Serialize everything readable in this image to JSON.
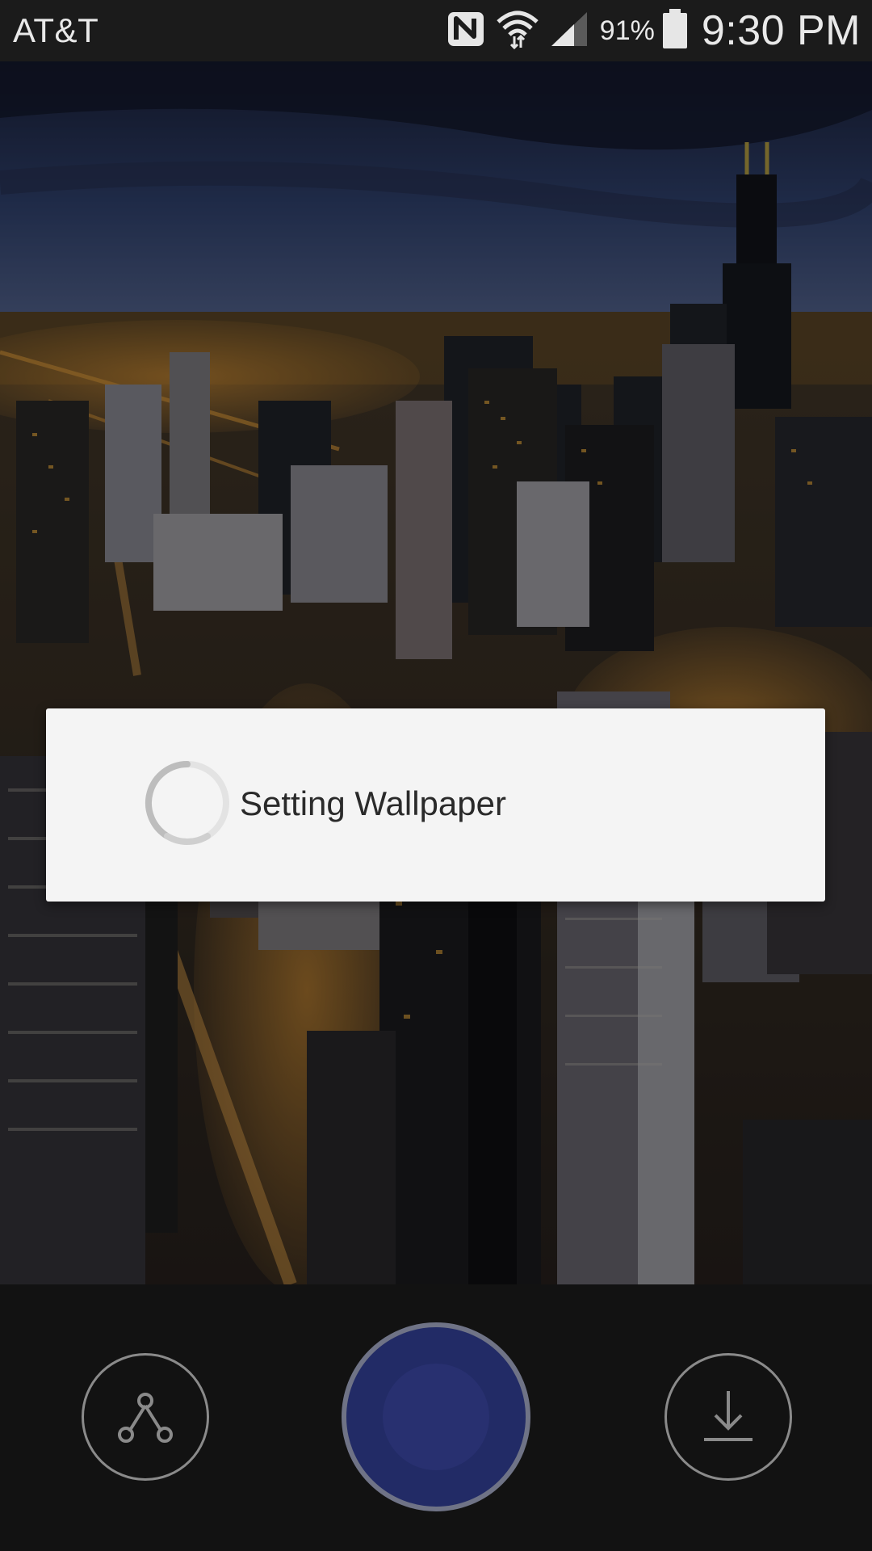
{
  "status_bar": {
    "carrier": "AT&T",
    "battery_percent": "91%",
    "time": "9:30 PM",
    "icons": [
      "nfc-icon",
      "wifi-icon",
      "signal-icon",
      "battery-icon"
    ]
  },
  "wallpaper": {
    "description_icon": "city-skyline-image"
  },
  "dialog": {
    "message": "Setting Wallpaper",
    "spinner_icon": "loading-spinner-icon"
  },
  "bottom_bar": {
    "share_icon": "share-icon",
    "apply_icon": "apply-wallpaper-button",
    "download_icon": "download-icon"
  },
  "colors": {
    "status_bar_bg": "#1b1b1b",
    "dialog_bg": "#f4f4f4",
    "apply_button": "#222b66",
    "bottom_bar_bg": "#121212"
  }
}
